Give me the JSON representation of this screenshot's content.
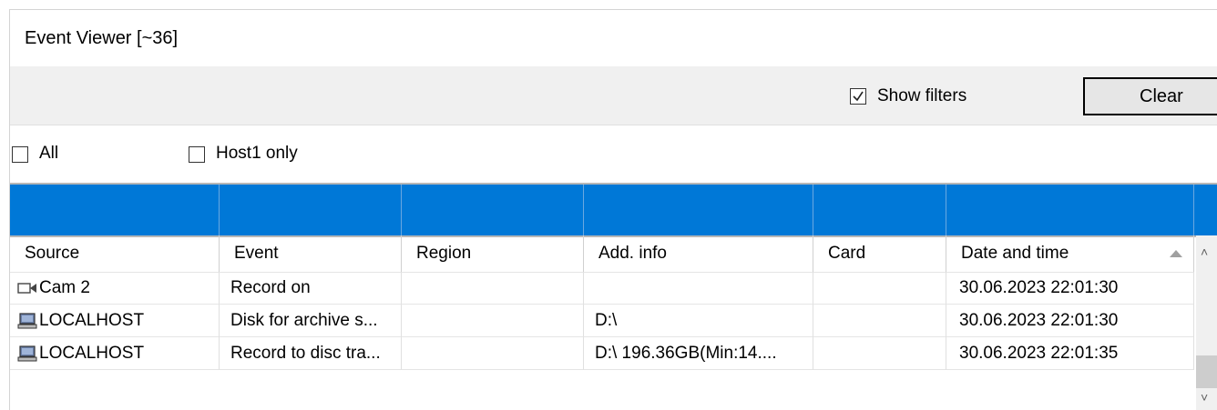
{
  "window": {
    "title": "Event Viewer [~36]"
  },
  "toolbar": {
    "show_filters_label": "Show filters",
    "show_filters_checked": true,
    "clear_label": "Clear"
  },
  "filters": {
    "all_label": "All",
    "all_checked": false,
    "host_label": "Host1 only",
    "host_checked": false
  },
  "columns": [
    "Source",
    "Event",
    "Region",
    "Add. info",
    "Card",
    "Date and time"
  ],
  "sort": {
    "column": "Date and time",
    "direction": "ascending"
  },
  "rows": [
    {
      "icon": "camera-icon",
      "source": "Cam 2",
      "event": "Record on",
      "region": "",
      "add_info": "",
      "card": "",
      "datetime": "30.06.2023 22:01:30"
    },
    {
      "icon": "computer-icon",
      "source": "LOCALHOST",
      "event": "Disk for archive s...",
      "region": "",
      "add_info": "D:\\",
      "card": "",
      "datetime": "30.06.2023 22:01:30"
    },
    {
      "icon": "computer-icon",
      "source": "LOCALHOST",
      "event": "Record to disc tra...",
      "region": "",
      "add_info": "D:\\ 196.36GB(Min:14....",
      "card": "",
      "datetime": "30.06.2023 22:01:35"
    }
  ],
  "colors": {
    "filter_row": "#0078d7",
    "toolbar_bg": "#f0f0f0"
  }
}
